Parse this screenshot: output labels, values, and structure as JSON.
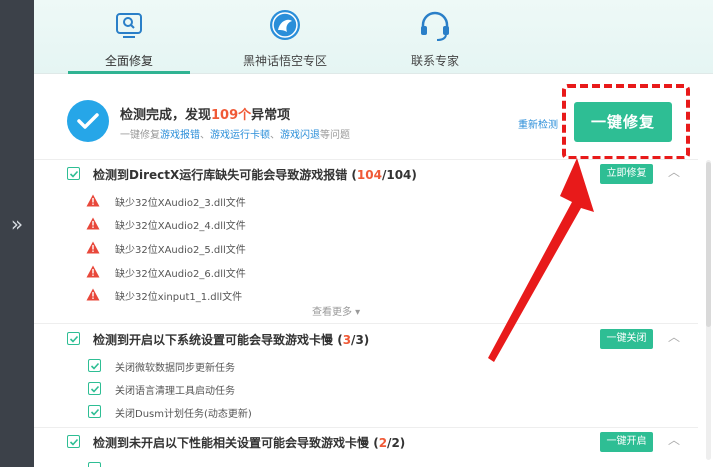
{
  "sidebar": {
    "toggle_icon": "chevron-double-right-icon",
    "toggle_glyph": "»"
  },
  "tabs": [
    {
      "label": "全面修复",
      "icon": "monitor-search-icon",
      "active": true
    },
    {
      "label": "黑神话悟空专区",
      "icon": "wukong-logo-icon",
      "active": false
    },
    {
      "label": "联系专家",
      "icon": "headset-icon",
      "active": false
    }
  ],
  "summary": {
    "title_prefix": "检测完成，发现",
    "count": "109个",
    "title_suffix": "异常项",
    "sub_prefix": "一键修复",
    "sub_link1": "游戏报错",
    "sub_sep1": "、",
    "sub_link2": "游戏运行卡顿",
    "sub_sep2": "、",
    "sub_link3": "游戏闪退",
    "sub_suffix": "等问题",
    "rescan": "重新检测",
    "fix_all": "一键修复"
  },
  "sections": [
    {
      "title": "检测到DirectX运行库缺失可能会导致游戏报错",
      "found": "104",
      "total": "104",
      "button": "立即修复",
      "items": [
        "缺少32位XAudio2_3.dll文件",
        "缺少32位XAudio2_4.dll文件",
        "缺少32位XAudio2_5.dll文件",
        "缺少32位XAudio2_6.dll文件",
        "缺少32位xinput1_1.dll文件"
      ],
      "more": "查看更多 ▾"
    },
    {
      "title": "检测到开启以下系统设置可能会导致游戏卡慢",
      "found": "3",
      "total": "3",
      "button": "一键关闭",
      "items": [
        "关闭微软数据同步更新任务",
        "关闭语言清理工具启动任务",
        "关闭Dusm计划任务(动态更新)"
      ]
    },
    {
      "title": "检测到未开启以下性能相关设置可能会导致游戏卡慢",
      "found": "2",
      "total": "2",
      "button": "一键开启"
    }
  ],
  "colors": {
    "accent": "#2ebe94",
    "warning": "#e8473a",
    "highlight": "#e81a1a",
    "link": "#2a8ed9",
    "count": "#f05a37"
  }
}
